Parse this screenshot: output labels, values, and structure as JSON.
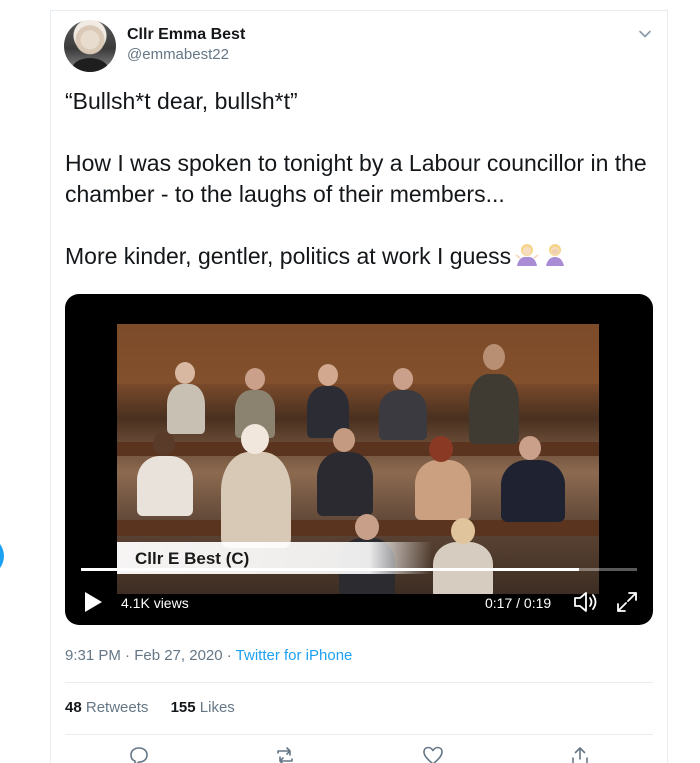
{
  "tweet": {
    "author": {
      "display_name": "Cllr Emma Best",
      "handle": "@emmabest22"
    },
    "text": {
      "line1": "“Bullsh*t dear, bullsh*t”",
      "line2": "How I was spoken to tonight by a Labour councillor in the chamber - to the laughs of their members...",
      "line3": "More kinder, gentler, politics at work I guess"
    },
    "video": {
      "caption": "Cllr E Best (C)",
      "views": "4.1K views",
      "time": "0:17 / 0:19",
      "progress": 0.895
    },
    "timestamp": "9:31 PM · Feb 27, 2020 · ",
    "source": "Twitter for iPhone",
    "stats": {
      "retweets_count": "48",
      "retweets_label": "Retweets",
      "likes_count": "155",
      "likes_label": "Likes"
    }
  },
  "colors": {
    "accent": "#1da1f2",
    "secondary_text": "#657786",
    "border": "#e6ecf0"
  },
  "icons": {
    "menu": "chevron-down-icon",
    "emoji1": "woman-shrugging-emoji",
    "emoji2": "woman-facepalming-emoji",
    "play": "play-icon",
    "volume": "volume-icon",
    "fullscreen": "fullscreen-icon",
    "reply": "reply-icon",
    "retweet": "retweet-icon",
    "like": "heart-icon",
    "share": "share-icon"
  }
}
